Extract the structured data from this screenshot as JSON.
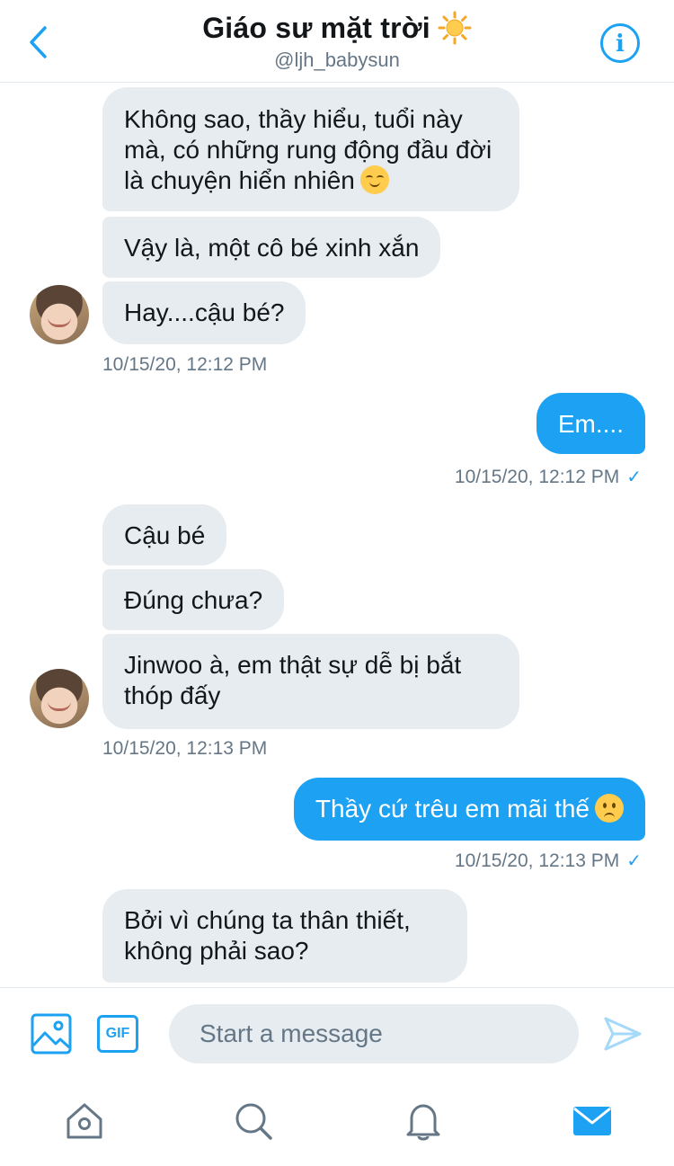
{
  "header": {
    "title": "Giáo sư mặt trời",
    "title_emoji": "sun-emoji",
    "handle": "@ljh_babysun"
  },
  "messages": [
    {
      "direction": "in",
      "text": "Không sao, thầy hiểu, tuổi này mà, có những rung động đầu đời là chuyện hiển nhiên",
      "emoji": "relieved-face-emoji"
    },
    {
      "direction": "in",
      "text": "Vậy là, một cô bé xinh xắn"
    },
    {
      "direction": "in",
      "text": "Hay....cậu bé?"
    },
    {
      "direction": "in",
      "timestamp": "10/15/20, 12:12 PM"
    },
    {
      "direction": "out",
      "text": "Em...."
    },
    {
      "direction": "out",
      "timestamp": "10/15/20, 12:12 PM",
      "read": "✓"
    },
    {
      "direction": "in",
      "text": "Cậu bé"
    },
    {
      "direction": "in",
      "text": "Đúng chưa?"
    },
    {
      "direction": "in",
      "text": "Jinwoo à, em thật sự dễ bị bắt thóp đấy"
    },
    {
      "direction": "in",
      "timestamp": "10/15/20, 12:13 PM"
    },
    {
      "direction": "out",
      "text": "Thầy cứ trêu em mãi thế",
      "emoji": "frowning-face-emoji"
    },
    {
      "direction": "out",
      "timestamp": "10/15/20, 12:13 PM",
      "read": "✓"
    },
    {
      "direction": "in",
      "text": "Bởi vì chúng ta thân thiết, không phải sao?"
    }
  ],
  "composer": {
    "gif_label": "GIF",
    "placeholder": "Start a message"
  },
  "tabs": [
    "home-icon",
    "search-icon",
    "notifications-icon",
    "messages-icon"
  ],
  "colors": {
    "accent": "#1da1f2",
    "incoming_bubble": "#e6ecf0",
    "secondary_text": "#657786"
  }
}
